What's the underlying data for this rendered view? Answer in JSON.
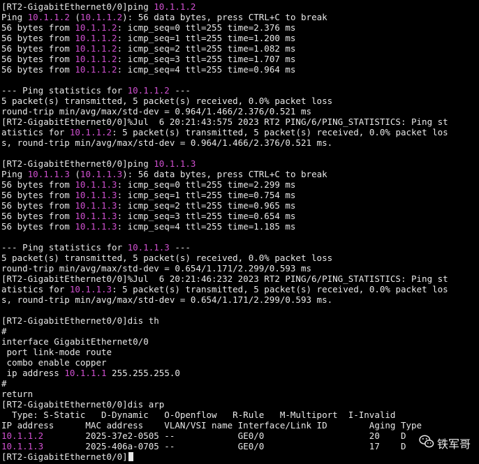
{
  "terminal": {
    "lines": [
      [
        {
          "t": "[RT2-GigabitEthernet0/0]ping "
        },
        {
          "t": "10.1.1.2",
          "c": "ip"
        }
      ],
      [
        {
          "t": "Ping "
        },
        {
          "t": "10.1.1.2",
          "c": "ip"
        },
        {
          "t": " ("
        },
        {
          "t": "10.1.1.2",
          "c": "ip"
        },
        {
          "t": "): 56 data bytes, press CTRL+C to break"
        }
      ],
      [
        {
          "t": "56 bytes from "
        },
        {
          "t": "10.1.1.2",
          "c": "ip"
        },
        {
          "t": ": icmp_seq=0 ttl=255 time=2.376 ms"
        }
      ],
      [
        {
          "t": "56 bytes from "
        },
        {
          "t": "10.1.1.2",
          "c": "ip"
        },
        {
          "t": ": icmp_seq=1 ttl=255 time=1.200 ms"
        }
      ],
      [
        {
          "t": "56 bytes from "
        },
        {
          "t": "10.1.1.2",
          "c": "ip"
        },
        {
          "t": ": icmp_seq=2 ttl=255 time=1.082 ms"
        }
      ],
      [
        {
          "t": "56 bytes from "
        },
        {
          "t": "10.1.1.2",
          "c": "ip"
        },
        {
          "t": ": icmp_seq=3 ttl=255 time=1.707 ms"
        }
      ],
      [
        {
          "t": "56 bytes from "
        },
        {
          "t": "10.1.1.2",
          "c": "ip"
        },
        {
          "t": ": icmp_seq=4 ttl=255 time=0.964 ms"
        }
      ],
      [
        {
          "t": ""
        }
      ],
      [
        {
          "t": "--- Ping statistics for "
        },
        {
          "t": "10.1.1.2",
          "c": "ip"
        },
        {
          "t": " ---"
        }
      ],
      [
        {
          "t": "5 packet(s) transmitted, 5 packet(s) received, 0.0% packet loss"
        }
      ],
      [
        {
          "t": "round-trip min/avg/max/std-dev = 0.964/1.466/2.376/0.521 ms"
        }
      ],
      [
        {
          "t": "[RT2-GigabitEthernet0/0]%Jul  6 20:21:43:575 2023 RT2 PING/6/PING_STATISTICS: Ping st"
        }
      ],
      [
        {
          "t": "atistics for "
        },
        {
          "t": "10.1.1.2",
          "c": "ip"
        },
        {
          "t": ": 5 packet(s) transmitted, 5 packet(s) received, 0.0% packet los"
        }
      ],
      [
        {
          "t": "s, round-trip min/avg/max/std-dev = 0.964/1.466/2.376/0.521 ms."
        }
      ],
      [
        {
          "t": ""
        }
      ],
      [
        {
          "t": "[RT2-GigabitEthernet0/0]ping "
        },
        {
          "t": "10.1.1.3",
          "c": "ip"
        }
      ],
      [
        {
          "t": "Ping "
        },
        {
          "t": "10.1.1.3",
          "c": "ip"
        },
        {
          "t": " ("
        },
        {
          "t": "10.1.1.3",
          "c": "ip"
        },
        {
          "t": "): 56 data bytes, press CTRL+C to break"
        }
      ],
      [
        {
          "t": "56 bytes from "
        },
        {
          "t": "10.1.1.3",
          "c": "ip"
        },
        {
          "t": ": icmp_seq=0 ttl=255 time=2.299 ms"
        }
      ],
      [
        {
          "t": "56 bytes from "
        },
        {
          "t": "10.1.1.3",
          "c": "ip"
        },
        {
          "t": ": icmp_seq=1 ttl=255 time=0.754 ms"
        }
      ],
      [
        {
          "t": "56 bytes from "
        },
        {
          "t": "10.1.1.3",
          "c": "ip"
        },
        {
          "t": ": icmp_seq=2 ttl=255 time=0.965 ms"
        }
      ],
      [
        {
          "t": "56 bytes from "
        },
        {
          "t": "10.1.1.3",
          "c": "ip"
        },
        {
          "t": ": icmp_seq=3 ttl=255 time=0.654 ms"
        }
      ],
      [
        {
          "t": "56 bytes from "
        },
        {
          "t": "10.1.1.3",
          "c": "ip"
        },
        {
          "t": ": icmp_seq=4 ttl=255 time=1.185 ms"
        }
      ],
      [
        {
          "t": ""
        }
      ],
      [
        {
          "t": "--- Ping statistics for "
        },
        {
          "t": "10.1.1.3",
          "c": "ip"
        },
        {
          "t": " ---"
        }
      ],
      [
        {
          "t": "5 packet(s) transmitted, 5 packet(s) received, 0.0% packet loss"
        }
      ],
      [
        {
          "t": "round-trip min/avg/max/std-dev = 0.654/1.171/2.299/0.593 ms"
        }
      ],
      [
        {
          "t": "[RT2-GigabitEthernet0/0]%Jul  6 20:21:46:232 2023 RT2 PING/6/PING_STATISTICS: Ping st"
        }
      ],
      [
        {
          "t": "atistics for "
        },
        {
          "t": "10.1.1.3",
          "c": "ip"
        },
        {
          "t": ": 5 packet(s) transmitted, 5 packet(s) received, 0.0% packet los"
        }
      ],
      [
        {
          "t": "s, round-trip min/avg/max/std-dev = 0.654/1.171/2.299/0.593 ms."
        }
      ],
      [
        {
          "t": ""
        }
      ],
      [
        {
          "t": "[RT2-GigabitEthernet0/0]dis th"
        }
      ],
      [
        {
          "t": "#"
        }
      ],
      [
        {
          "t": "interface GigabitEthernet0/0"
        }
      ],
      [
        {
          "t": " port link-mode route"
        }
      ],
      [
        {
          "t": " combo enable copper"
        }
      ],
      [
        {
          "t": " ip address "
        },
        {
          "t": "10.1.1.1",
          "c": "ip"
        },
        {
          "t": " 255.255.255.0"
        }
      ],
      [
        {
          "t": "#"
        }
      ],
      [
        {
          "t": "return"
        }
      ],
      [
        {
          "t": "[RT2-GigabitEthernet0/0]dis arp"
        }
      ],
      [
        {
          "t": "  Type: S-Static   D-Dynamic   O-Openflow   R-Rule   M-Multiport  I-Invalid"
        }
      ],
      [
        {
          "t": "IP address      MAC address    VLAN/VSI name Interface/Link ID        Aging Type"
        }
      ],
      [
        {
          "t": "10.1.1.2",
          "c": "ip"
        },
        {
          "t": "        2025-37e2-0505 --            GE0/0                    20    D"
        }
      ],
      [
        {
          "t": "10.1.1.3",
          "c": "ip"
        },
        {
          "t": "        2025-406a-0705 --            GE0/0                    17    D"
        }
      ],
      [
        {
          "t": "[RT2-GigabitEthernet0/0]"
        },
        {
          "cursor": true
        }
      ]
    ]
  },
  "watermark": {
    "icon": "wechat-icon",
    "text": "铁军哥"
  },
  "colors": {
    "background": "#000000",
    "text": "#e8e8e8",
    "ip_highlight": "#d050d0"
  }
}
